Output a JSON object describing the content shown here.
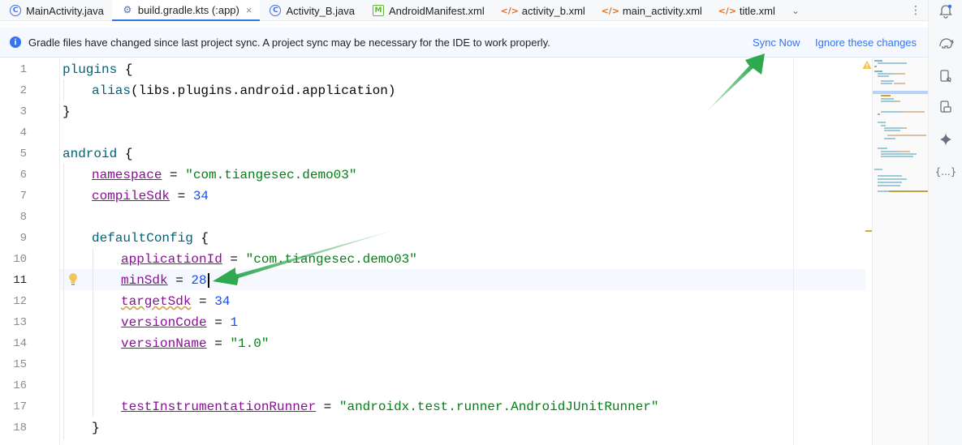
{
  "tabs": [
    {
      "label": "MainActivity.java",
      "icon": "java-class-icon"
    },
    {
      "label": "build.gradle.kts (:app)",
      "icon": "gradle-icon",
      "active": true
    },
    {
      "label": "Activity_B.java",
      "icon": "java-class-icon"
    },
    {
      "label": "AndroidManifest.xml",
      "icon": "manifest-icon"
    },
    {
      "label": "activity_b.xml",
      "icon": "xml-icon"
    },
    {
      "label": "main_activity.xml",
      "icon": "xml-icon"
    },
    {
      "label": "title.xml",
      "icon": "xml-icon"
    }
  ],
  "banner": {
    "message": "Gradle files have changed since last project sync. A project sync may be necessary for the IDE to work properly.",
    "sync_now": "Sync Now",
    "ignore": "Ignore these changes"
  },
  "editor": {
    "line_numbers": [
      "1",
      "2",
      "3",
      "4",
      "5",
      "6",
      "7",
      "8",
      "9",
      "10",
      "11",
      "12",
      "13",
      "14",
      "15",
      "16",
      "17",
      "18"
    ],
    "current_line": "11",
    "code": {
      "l1_kw": "plugins",
      "l1_brace": " {",
      "l2_fn": "alias",
      "l2_arg": "(libs.plugins.android.application)",
      "l3": "}",
      "l5_kw": "android",
      "l5_brace": " {",
      "l6_prop": "namespace",
      "l6_eq": " = ",
      "l6_val": "\"com.tiangesec.demo03\"",
      "l7_prop": "compileSdk",
      "l7_eq": " = ",
      "l7_val": "34",
      "l9_kw": "defaultConfig",
      "l9_brace": " {",
      "l10_prop": "applicationId",
      "l10_eq": " = ",
      "l10_val": "\"com.tiangesec.demo03\"",
      "l11_prop": "minSdk",
      "l11_eq": " = ",
      "l11_val": "28",
      "l12_prop": "targetSdk",
      "l12_eq": " = ",
      "l12_val": "34",
      "l13_prop": "versionCode",
      "l13_eq": " = ",
      "l13_val": "1",
      "l14_prop": "versionName",
      "l14_eq": " = ",
      "l14_val": "\"1.0\"",
      "l17_prop": "testInstrumentationRunner",
      "l17_eq": " = ",
      "l17_val": "\"androidx.test.runner.AndroidJUnitRunner\"",
      "l18": "}"
    }
  },
  "toolstrip": {
    "icons": [
      "notifications-icon",
      "gradle-elephant-icon",
      "device-manager-icon",
      "running-devices-icon",
      "ai-assistant-icon",
      "json-icon"
    ],
    "json_label": "{...}"
  },
  "colors": {
    "accent": "#3574f0",
    "annotation_arrow": "#2fa84f",
    "banner_bg": "#f5f8fe"
  }
}
